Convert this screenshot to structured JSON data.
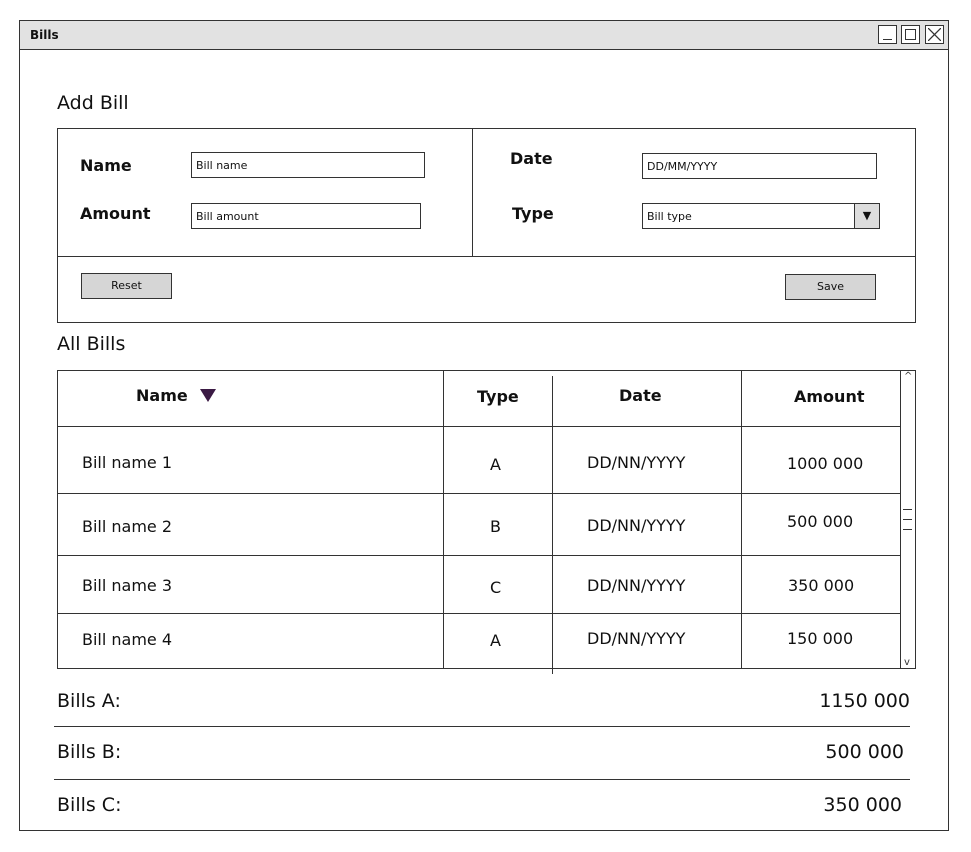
{
  "window": {
    "title": "Bills"
  },
  "add_bill": {
    "title": "Add Bill",
    "name_label": "Name",
    "name_placeholder": "Bill name",
    "amount_label": "Amount",
    "amount_placeholder": "Bill amount",
    "date_label": "Date",
    "date_placeholder": "DD/MM/YYYY",
    "type_label": "Type",
    "type_selected": "Bill type",
    "reset_label": "Reset",
    "save_label": "Save"
  },
  "all_bills": {
    "title": "All Bills",
    "columns": [
      "Name",
      "Type",
      "Date",
      "Amount"
    ],
    "rows": [
      {
        "name": "Bill name 1",
        "type": "A",
        "date": "DD/NN/YYYY",
        "amount": "1000 000"
      },
      {
        "name": "Bill name 2",
        "type": "B",
        "date": "DD/NN/YYYY",
        "amount": "500 000"
      },
      {
        "name": "Bill name 3",
        "type": "C",
        "date": "DD/NN/YYYY",
        "amount": "350 000"
      },
      {
        "name": "Bill name 4",
        "type": "A",
        "date": "DD/NN/YYYY",
        "amount": "150 000"
      }
    ]
  },
  "summary": [
    {
      "label": "Bills A:",
      "value": "1150 000"
    },
    {
      "label": "Bills B:",
      "value": "500 000"
    },
    {
      "label": "Bills C:",
      "value": "350 000"
    }
  ]
}
